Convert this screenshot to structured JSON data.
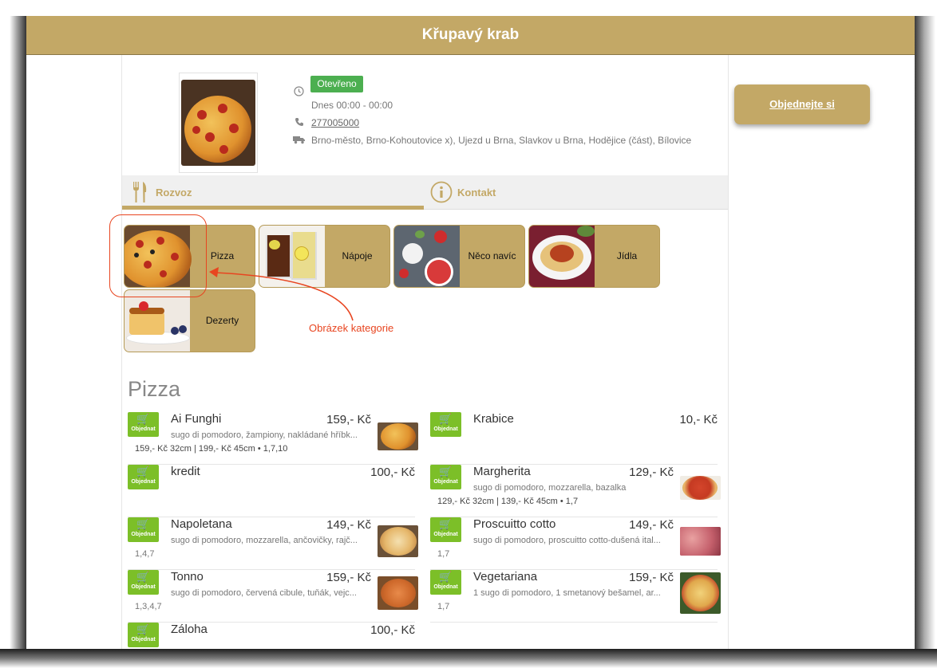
{
  "header": {
    "title": "Křupavý krab"
  },
  "restaurant": {
    "status": "Otevřeno",
    "hours": "Dnes 00:00 - 00:00",
    "phone": "277005000",
    "delivery_areas": "Brno-město, Brno-Kohoutovice x), Ujezd u Brna, Slavkov u Brna, Hodějice (část), Bílovice"
  },
  "tabs": [
    {
      "label": "Rozvoz",
      "icon": "fork-knife-icon"
    },
    {
      "label": "Kontakt",
      "icon": "info-icon"
    }
  ],
  "categories": [
    {
      "label": "Pizza"
    },
    {
      "label": "Nápoje"
    },
    {
      "label": "Něco navíc"
    },
    {
      "label": "Jídla"
    },
    {
      "label": "Dezerty"
    }
  ],
  "annotation": "Obrázek kategorie",
  "section_title": "Pizza",
  "order_button": "Objednejte si",
  "cart_label": "Objednat",
  "products": [
    {
      "name": "Ai Funghi",
      "price": "159,- Kč",
      "desc": "sugo di pomodoro, žampiony, nakládané hříbk...",
      "sizes": "159,- Kč 32cm   |   199,- Kč 45cm   • 1,7,10"
    },
    {
      "name": "Krabice",
      "price": "10,- Kč"
    },
    {
      "name": "kredit",
      "price": "100,- Kč"
    },
    {
      "name": "Margherita",
      "price": "129,- Kč",
      "desc": "sugo di pomodoro, mozzarella, bazalka",
      "sizes": "129,- Kč 32cm   |   139,- Kč 45cm   • 1,7"
    },
    {
      "name": "Napoletana",
      "price": "149,- Kč",
      "desc": "sugo di pomodoro, mozzarella, ančovičky, rajč...",
      "allergens": "1,4,7"
    },
    {
      "name": "Proscuitto cotto",
      "price": "149,- Kč",
      "desc": "sugo di pomodoro, proscuitto cotto-dušená ital...",
      "allergens": "1,7"
    },
    {
      "name": "Tonno",
      "price": "159,- Kč",
      "desc": "sugo di pomodoro, červená cibule, tuňák, vejc...",
      "allergens": "1,3,4,7"
    },
    {
      "name": "Vegetariana",
      "price": "159,- Kč",
      "desc": "1 sugo di pomodoro, 1 smetanový bešamel, ar...",
      "allergens": "1,7"
    },
    {
      "name": "Záloha",
      "price": "100,- Kč"
    }
  ],
  "colors": {
    "brand": "#c3a866",
    "open_badge": "#4caf50",
    "cart": "#7cbf28",
    "annotation": "#e84520"
  }
}
